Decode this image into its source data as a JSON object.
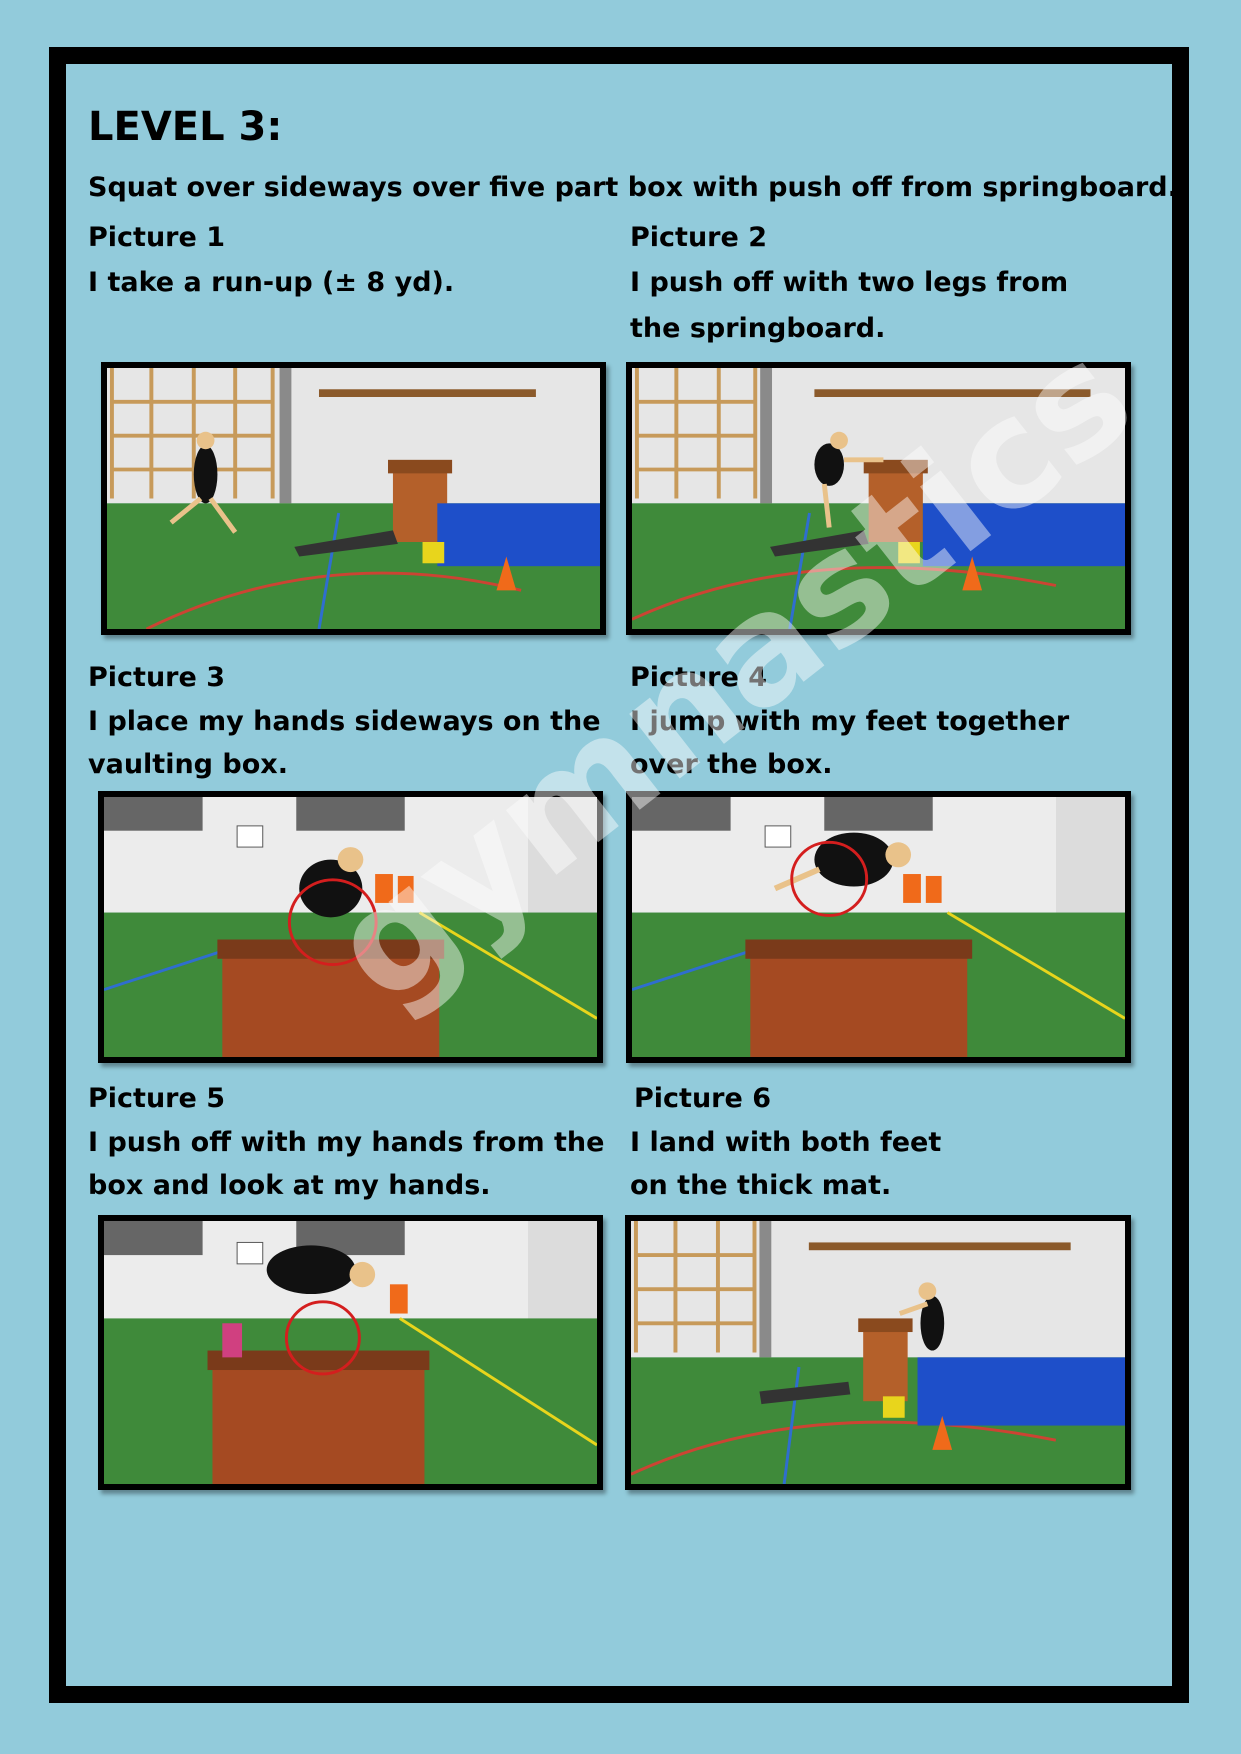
{
  "title": "LEVEL 3:",
  "subtitle": "Squat over sideways over five part box with push off from springboard.",
  "pictures": [
    {
      "heading": "Picture 1",
      "caption": "I take a run-up (± 8 yd)."
    },
    {
      "heading": "Picture 2",
      "caption": "I push off with two legs from the springboard."
    },
    {
      "heading": "Picture 3",
      "caption": "I place my hands sideways on the vaulting box."
    },
    {
      "heading": "Picture 4",
      "caption": "I jump with my feet together over the box."
    },
    {
      "heading": "Picture 5",
      "caption": "I push off with my hands from the box and look at my hands."
    },
    {
      "heading": "Picture 6",
      "caption": "I land with both feet on the thick mat."
    }
  ],
  "watermark": "gymnastics"
}
